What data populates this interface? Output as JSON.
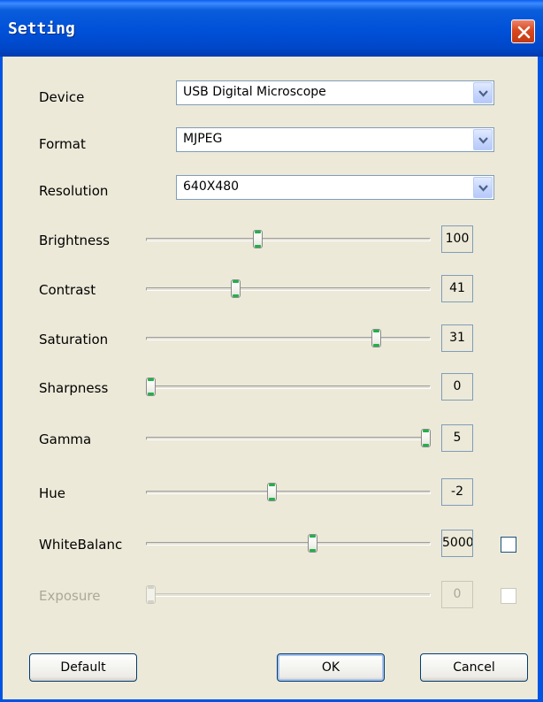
{
  "window": {
    "title": "Setting",
    "close_icon": "close-icon"
  },
  "device": {
    "label": "Device",
    "value": "USB Digital Microscope"
  },
  "format": {
    "label": "Format",
    "value": "MJPEG"
  },
  "resolution": {
    "label": "Resolution",
    "value": "640X480"
  },
  "sliders": [
    {
      "label": "Brightness",
      "value": "100",
      "level": 0.39,
      "enabled": true
    },
    {
      "label": "Contrast",
      "value": "41",
      "level": 0.31,
      "enabled": true
    },
    {
      "label": "Saturation",
      "value": "31",
      "level": 0.82,
      "enabled": true
    },
    {
      "label": "Sharpness",
      "value": "0",
      "level": 0.0,
      "enabled": true
    },
    {
      "label": "Gamma",
      "value": "5",
      "level": 1.0,
      "enabled": true
    },
    {
      "label": "Hue",
      "value": "-2",
      "level": 0.44,
      "enabled": true
    },
    {
      "label": "WhiteBalanc",
      "value": "5000",
      "level": 0.59,
      "enabled": true,
      "checkbox": {
        "checked": false
      }
    },
    {
      "label": "Exposure",
      "value": "0",
      "level": 0.0,
      "enabled": false,
      "checkbox": {
        "checked": false
      }
    }
  ],
  "buttons": {
    "default": "Default",
    "ok": "OK",
    "cancel": "Cancel"
  },
  "colors": {
    "title_bar": "#0054E3",
    "client_bg": "#ECE9D8",
    "slider_grip": "#22B04A",
    "disabled_text": "#ACA899"
  }
}
